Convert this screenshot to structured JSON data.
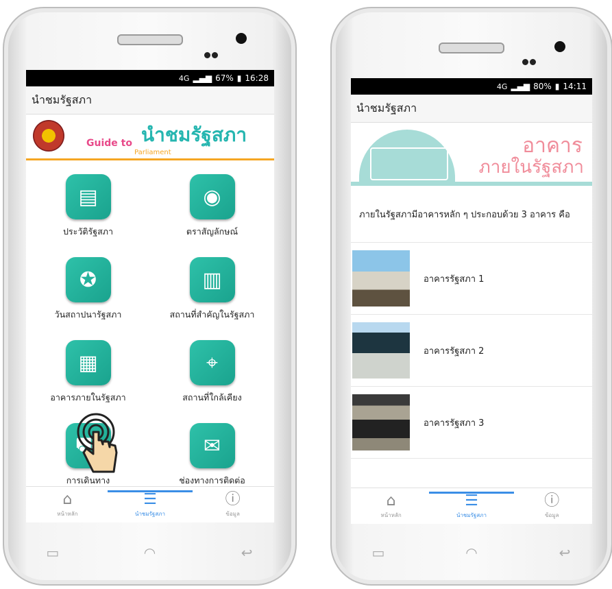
{
  "left": {
    "status": {
      "network": "4G",
      "battery": "67%",
      "time": "16:28"
    },
    "app_title": "นำชมรัฐสภา",
    "banner": {
      "guide": "Guide to",
      "thai": "นำชมรัฐสภา",
      "sub": "Parliament"
    },
    "menu": [
      {
        "label": "ประวัติรัฐสภา",
        "icon": "document-clock-icon",
        "glyph": "▤"
      },
      {
        "label": "ตราสัญลักษณ์",
        "icon": "parliament-emblem-icon",
        "glyph": "◉"
      },
      {
        "label": "วันสถาปนารัฐสภา",
        "icon": "award-ribbon-icon",
        "glyph": "✪"
      },
      {
        "label": "สถานที่สำคัญในรัฐสภา",
        "icon": "city-location-icon",
        "glyph": "▥"
      },
      {
        "label": "อาคารภายในรัฐสภา",
        "icon": "building-icon",
        "glyph": "▦"
      },
      {
        "label": "สถานที่ใกล้เคียง",
        "icon": "map-pin-icon",
        "glyph": "⌖"
      },
      {
        "label": "การเดินทาง",
        "icon": "car-icon",
        "glyph": "⛟"
      },
      {
        "label": "ช่องทางการติดต่อ",
        "icon": "mail-contact-icon",
        "glyph": "✉"
      }
    ]
  },
  "right": {
    "status": {
      "network": "4G",
      "battery": "80%",
      "time": "14:11"
    },
    "app_title": "นำชมรัฐสภา",
    "banner": {
      "line1": "อาคาร",
      "line2": "ภายในรัฐสภา"
    },
    "intro": "ภายในรัฐสภามีอาคารหลัก ๆ ประกอบด้วย 3 อาคาร คือ",
    "buildings": [
      "อาคารรัฐสภา 1",
      "อาคารรัฐสภา 2",
      "อาคารรัฐสภา 3"
    ]
  },
  "nav": {
    "home": "หน้าหลัก",
    "tour": "นำชมรัฐสภา",
    "info": "ข้อมูล"
  },
  "colors": {
    "teal": "#26b6b0",
    "pink": "#e84a8a",
    "orange": "#f5a623",
    "blue": "#3a8ee6"
  }
}
